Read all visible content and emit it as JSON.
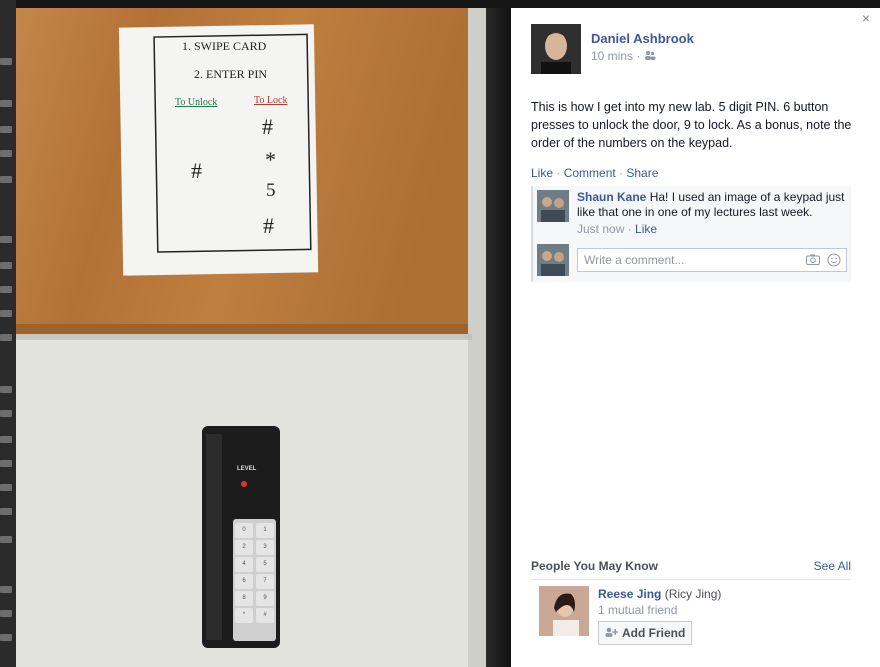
{
  "photo": {
    "sign_lines": [
      "1. SWIPE CARD",
      "2. ENTER PIN"
    ],
    "unlock_label": "To Unlock",
    "lock_label": "To Lock",
    "unlock_sequence": [
      "#"
    ],
    "lock_sequence": [
      "#",
      "*",
      "5",
      "#"
    ],
    "keypad_brand": "LEVEL",
    "keypad_keys": [
      "0",
      "1",
      "2",
      "3",
      "4",
      "5",
      "6",
      "7",
      "8",
      "9",
      "*",
      "#"
    ]
  },
  "post": {
    "close_glyph": "×",
    "author_name": "Daniel Ashbrook",
    "time": "10 mins ·",
    "audience_icon": "friends-icon",
    "text": "This is how I get into my new lab. 5 digit PIN. 6 button presses to unlock the door, 9 to lock. As a bonus, note the order of the numbers on the keypad.",
    "actions": {
      "like": "Like",
      "comment": "Comment",
      "share": "Share",
      "separator": " · "
    }
  },
  "comment": {
    "author": "Shaun Kane",
    "text": "Ha! I used an image of a keypad just like that one in one of my lectures last week.",
    "time": "Just now",
    "separator": " · ",
    "like": "Like"
  },
  "write_comment": {
    "placeholder": "Write a comment..."
  },
  "pymk": {
    "title": "People You May Know",
    "see_all": "See All",
    "person": {
      "name": "Reese Jing",
      "alt_name": "(Ricy Jing)",
      "mutual": "1 mutual friend",
      "add_label": "Add Friend"
    }
  },
  "colors": {
    "link": "#3b5998",
    "muted": "#9197a3",
    "wood": "#b5773a",
    "wall": "#dcdcd6"
  }
}
